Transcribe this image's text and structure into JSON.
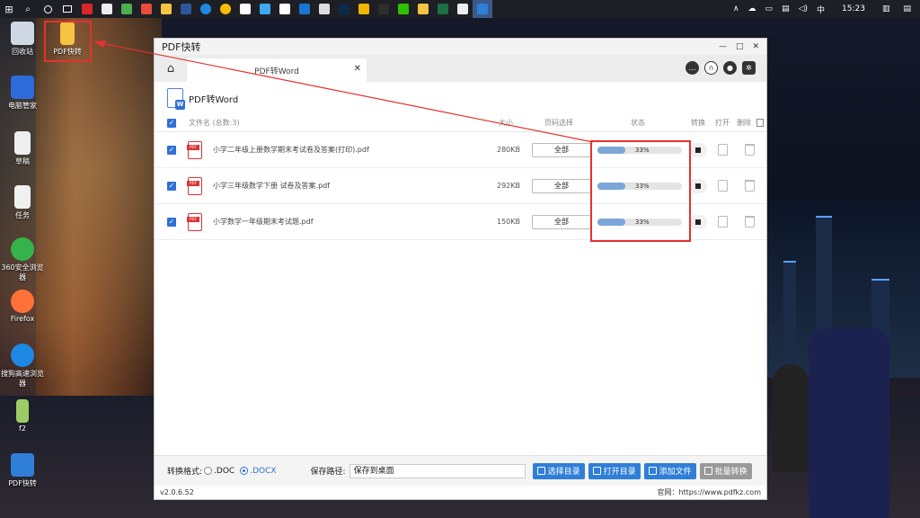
{
  "taskbar": {
    "time": "15:23",
    "ime": "中",
    "tray_icons": [
      "chevron-up-icon",
      "cloud-icon",
      "battery-icon",
      "network-icon",
      "volume-icon"
    ]
  },
  "desktop": {
    "icons": [
      {
        "label": "回收站",
        "icon": "recycle-bin-icon"
      },
      {
        "label": "PDF快转",
        "icon": "folder-icon"
      },
      {
        "label": "电脑管家",
        "icon": "pc-manager-icon"
      },
      {
        "label": "草稿",
        "icon": "draft-icon"
      },
      {
        "label": "任务",
        "icon": "task-icon"
      },
      {
        "label": "360安全浏览器",
        "icon": "browser-360-icon"
      },
      {
        "label": "Firefox",
        "icon": "firefox-icon"
      },
      {
        "label": "搜狗高速浏览器",
        "icon": "sogou-icon"
      },
      {
        "label": "f2",
        "icon": "f2-icon"
      },
      {
        "label": "PDF快转",
        "icon": "pdf-kuaizhuan-icon"
      }
    ]
  },
  "window": {
    "title": "PDF快转",
    "tab_label": "PDF转Word",
    "page_title": "PDF转Word"
  },
  "table": {
    "headers": {
      "filename": "文件名 (总数:3)",
      "size": "大小",
      "pages": "页码选择",
      "status": "状态",
      "convert": "转换",
      "open": "打开",
      "delete": "删除"
    },
    "rows": [
      {
        "name": "小学二年级上册数学期末考试卷及答案(打印).pdf",
        "size": "280KB",
        "pages": "全部",
        "progress": 33,
        "progress_text": "33%"
      },
      {
        "name": "小学三年级数学下册 试卷及答案.pdf",
        "size": "292KB",
        "pages": "全部",
        "progress": 33,
        "progress_text": "33%"
      },
      {
        "name": "小学数学一年级期末考试题.pdf",
        "size": "150KB",
        "pages": "全部",
        "progress": 33,
        "progress_text": "33%"
      }
    ]
  },
  "footer": {
    "format_label": "转换格式:",
    "opt_doc": ".DOC",
    "opt_docx": ".DOCX",
    "selected_format": ".DOCX",
    "save_label": "保存路径:",
    "save_path": "保存到桌面",
    "btn_select_dir": "选择目录",
    "btn_open_dir": "打开目录",
    "btn_add_file": "添加文件",
    "btn_batch": "批量转换"
  },
  "status": {
    "version": "v2.0.6.52",
    "website": "官网：https://www.pdfkz.com"
  },
  "colors": {
    "accent": "#2f7fd9",
    "highlight": "#e5322d",
    "progress": "#7ba6d8"
  }
}
